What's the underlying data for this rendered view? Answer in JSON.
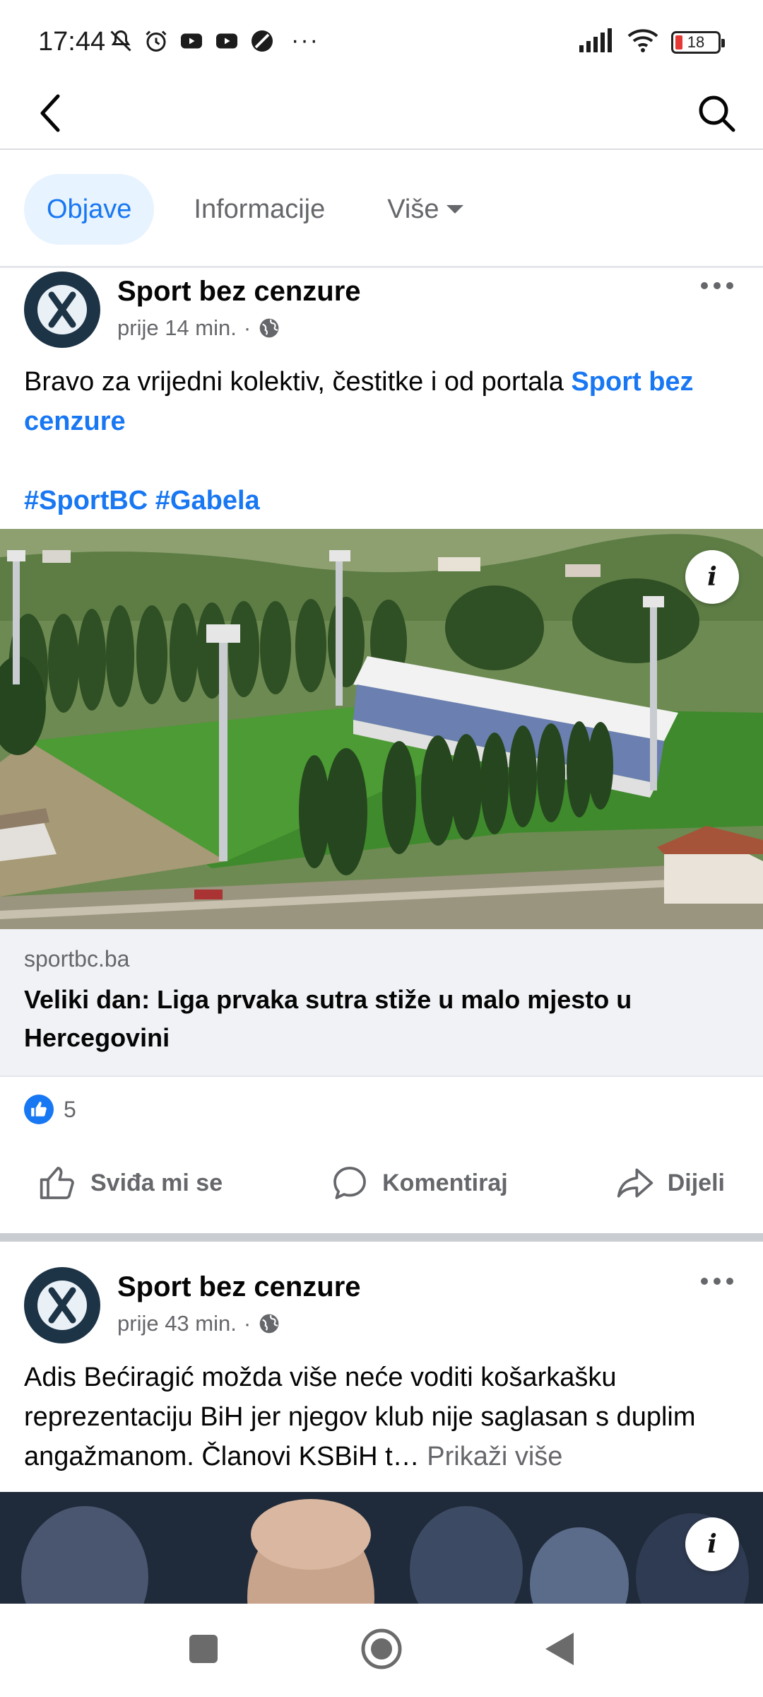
{
  "status_bar": {
    "time": "17:44",
    "left_icons": [
      "mute-icon",
      "alarm-icon",
      "youtube-icon",
      "youtube-icon",
      "data-saver-icon"
    ],
    "more": "···",
    "battery": "18",
    "signal": "signal-icon",
    "wifi": "wifi-icon"
  },
  "header": {
    "back_icon": "back-arrow-icon",
    "search_icon": "search-icon"
  },
  "tabs": [
    {
      "label": "Objave",
      "active": true
    },
    {
      "label": "Informacije",
      "active": false
    },
    {
      "label": "Više",
      "active": false
    }
  ],
  "posts": [
    {
      "page_name": "Sport bez cenzure",
      "time": "prije 14 min.",
      "dot": "·",
      "text_plain": "Bravo za vrijedni kolektiv, čestitke i od portala ",
      "text_link": "Sport bez cenzure",
      "hashtags": "#SportBC #Gabela",
      "image_alt": "Aerial view of a football stadium",
      "link_domain": "sportbc.ba",
      "link_title": "Veliki dan: Liga prvaka sutra stiže u malo mjesto u Hercegovini",
      "reaction_count": "5"
    },
    {
      "page_name": "Sport bez cenzure",
      "time": "prije 43 min.",
      "dot": "·",
      "text_plain": "Adis Bećiragić možda više neće voditi košarkašku reprezentaciju BiH jer njegov klub nije saglasan s duplim angažmanom. Članovi KSBiH t…",
      "see_more": " Prikaži više"
    }
  ],
  "actions": {
    "like": "Sviđa mi se",
    "comment": "Komentiraj",
    "share": "Dijeli"
  },
  "info_glyph": "i",
  "colors": {
    "accent": "#1877f2",
    "tab_active_bg": "#e7f3ff",
    "secondary_text": "#65676b",
    "separator": "#c9ccd1"
  }
}
